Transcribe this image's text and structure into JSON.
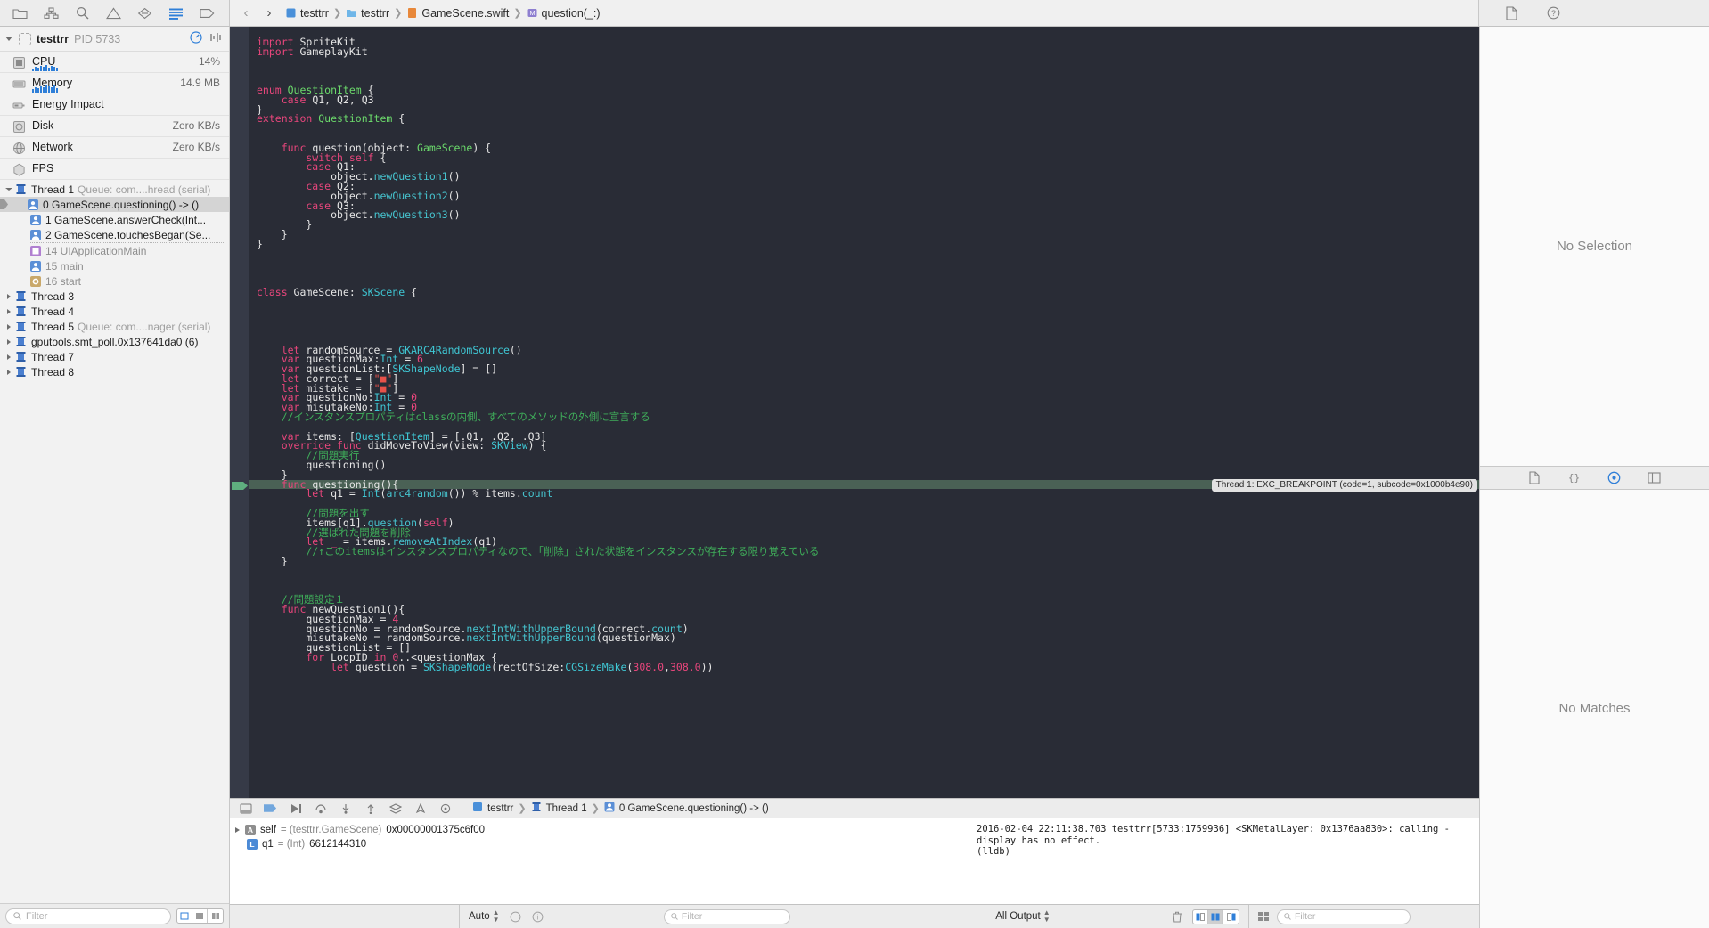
{
  "toolbar": {
    "nav_icons": [
      "folder-icon",
      "hierarchy-icon",
      "search-icon",
      "warning-icon",
      "breakpoint-icon",
      "debug-navigator-icon",
      "tag-icon"
    ],
    "back_label": "‹",
    "forward_label": "›",
    "breadcrumb": [
      {
        "label": "testtrr",
        "icon": "project-icon"
      },
      {
        "label": "testtrr",
        "icon": "folder-icon"
      },
      {
        "label": "GameScene.swift",
        "icon": "swift-file-icon"
      },
      {
        "label": "question(_:)",
        "icon": "method-icon"
      }
    ],
    "right_icons": [
      "document-icon",
      "help-icon"
    ]
  },
  "navigator": {
    "process": {
      "name": "testtrr",
      "pid_label": "PID 5733"
    },
    "gauges": [
      {
        "name": "CPU",
        "value": "14%",
        "icon": "cpu-icon",
        "spark": [
          2,
          4,
          3,
          5,
          4,
          6,
          3,
          5,
          4,
          3
        ]
      },
      {
        "name": "Memory",
        "value": "14.9 MB",
        "icon": "memory-icon",
        "spark": [
          3,
          5,
          4,
          6,
          5,
          7,
          6,
          5,
          7,
          4
        ]
      },
      {
        "name": "Energy Impact",
        "value": "",
        "icon": "energy-icon",
        "spark": []
      },
      {
        "name": "Disk",
        "value": "Zero KB/s",
        "icon": "disk-icon",
        "spark": []
      },
      {
        "name": "Network",
        "value": "Zero KB/s",
        "icon": "network-icon",
        "spark": []
      },
      {
        "name": "FPS",
        "value": "",
        "icon": "fps-icon",
        "spark": []
      }
    ],
    "threads": [
      {
        "kind": "thread",
        "label": "Thread 1",
        "sub": "Queue: com....hread (serial)",
        "expanded": true,
        "indent": 0
      },
      {
        "kind": "frame",
        "label": "0 GameScene.questioning() -> ()",
        "indent": 2,
        "selected": true,
        "color": "#5b8fd6"
      },
      {
        "kind": "frame",
        "label": "1 GameScene.answerCheck(Int...",
        "indent": 2,
        "color": "#5b8fd6"
      },
      {
        "kind": "frame",
        "label": "2 GameScene.touchesBegan(Se...",
        "indent": 2,
        "color": "#5b8fd6"
      },
      {
        "kind": "separator",
        "indent": 2
      },
      {
        "kind": "frame",
        "label": "14 UIApplicationMain",
        "indent": 2,
        "dim": true,
        "color": "#b07fd0"
      },
      {
        "kind": "frame",
        "label": "15 main",
        "indent": 2,
        "dim": true,
        "color": "#5b8fd6"
      },
      {
        "kind": "frame",
        "label": "16 start",
        "indent": 2,
        "dim": true,
        "color": "#c9a86a"
      },
      {
        "kind": "thread",
        "label": "Thread 3",
        "sub": "",
        "expanded": false,
        "indent": 0
      },
      {
        "kind": "thread",
        "label": "Thread 4",
        "sub": "",
        "expanded": false,
        "indent": 0
      },
      {
        "kind": "thread",
        "label": "Thread 5",
        "sub": "Queue: com....nager (serial)",
        "expanded": false,
        "indent": 0
      },
      {
        "kind": "thread",
        "label": "gputools.smt_poll.0x137641da0 (6)",
        "sub": "",
        "expanded": false,
        "indent": 0
      },
      {
        "kind": "thread",
        "label": "Thread 7",
        "sub": "",
        "expanded": false,
        "indent": 0
      },
      {
        "kind": "thread",
        "label": "Thread 8",
        "sub": "",
        "expanded": false,
        "indent": 0
      }
    ],
    "filter_placeholder": "Filter"
  },
  "editor": {
    "lines": [
      [
        {
          "t": "import ",
          "c": "kw"
        },
        {
          "t": "SpriteKit",
          "c": "pl"
        }
      ],
      [
        {
          "t": "import ",
          "c": "kw"
        },
        {
          "t": "GameplayKit",
          "c": "pl"
        }
      ],
      [],
      [],
      [],
      [
        {
          "t": "enum ",
          "c": "kw"
        },
        {
          "t": "QuestionItem",
          "c": "cls"
        },
        {
          "t": " {",
          "c": "pl"
        }
      ],
      [
        {
          "t": "    case ",
          "c": "kw"
        },
        {
          "t": "Q1, Q2, Q3",
          "c": "pl"
        }
      ],
      [
        {
          "t": "}",
          "c": "pl"
        }
      ],
      [
        {
          "t": "extension ",
          "c": "kw"
        },
        {
          "t": "QuestionItem",
          "c": "cls"
        },
        {
          "t": " {",
          "c": "pl"
        }
      ],
      [],
      [],
      [
        {
          "t": "    func ",
          "c": "kw"
        },
        {
          "t": "question",
          "c": "pl"
        },
        {
          "t": "(object: ",
          "c": "pl"
        },
        {
          "t": "GameScene",
          "c": "cls"
        },
        {
          "t": ") {",
          "c": "pl"
        }
      ],
      [
        {
          "t": "        switch self",
          "c": "kw"
        },
        {
          "t": " {",
          "c": "pl"
        }
      ],
      [
        {
          "t": "        case ",
          "c": "kw"
        },
        {
          "t": "Q1:",
          "c": "pl"
        }
      ],
      [
        {
          "t": "            object.",
          "c": "pl"
        },
        {
          "t": "newQuestion1",
          "c": "fn"
        },
        {
          "t": "()",
          "c": "pl"
        }
      ],
      [
        {
          "t": "        case ",
          "c": "kw"
        },
        {
          "t": "Q2:",
          "c": "pl"
        }
      ],
      [
        {
          "t": "            object.",
          "c": "pl"
        },
        {
          "t": "newQuestion2",
          "c": "fn"
        },
        {
          "t": "()",
          "c": "pl"
        }
      ],
      [
        {
          "t": "        case ",
          "c": "kw"
        },
        {
          "t": "Q3:",
          "c": "pl"
        }
      ],
      [
        {
          "t": "            object.",
          "c": "pl"
        },
        {
          "t": "newQuestion3",
          "c": "fn"
        },
        {
          "t": "()",
          "c": "pl"
        }
      ],
      [
        {
          "t": "        }",
          "c": "pl"
        }
      ],
      [
        {
          "t": "    }",
          "c": "pl"
        }
      ],
      [
        {
          "t": "}",
          "c": "pl"
        }
      ],
      [],
      [],
      [],
      [],
      [
        {
          "t": "class ",
          "c": "kw"
        },
        {
          "t": "GameScene",
          "c": "pl"
        },
        {
          "t": ": ",
          "c": "pl"
        },
        {
          "t": "SKScene",
          "c": "typ"
        },
        {
          "t": " {",
          "c": "pl"
        }
      ],
      [],
      [],
      [],
      [],
      [],
      [
        {
          "t": "    let ",
          "c": "kw"
        },
        {
          "t": "randomSource = ",
          "c": "pl"
        },
        {
          "t": "GKARC4RandomSource",
          "c": "typ"
        },
        {
          "t": "()",
          "c": "pl"
        }
      ],
      [
        {
          "t": "    var ",
          "c": "kw"
        },
        {
          "t": "questionMax:",
          "c": "pl"
        },
        {
          "t": "Int",
          "c": "typ"
        },
        {
          "t": " = ",
          "c": "pl"
        },
        {
          "t": "6",
          "c": "num"
        }
      ],
      [
        {
          "t": "    var ",
          "c": "kw"
        },
        {
          "t": "questionList:[",
          "c": "pl"
        },
        {
          "t": "SKShapeNode",
          "c": "typ"
        },
        {
          "t": "] = []",
          "c": "pl"
        }
      ],
      [
        {
          "t": "    let ",
          "c": "kw"
        },
        {
          "t": "correct = [",
          "c": "pl"
        },
        {
          "t": "\"■\"",
          "c": "str"
        },
        {
          "t": "]",
          "c": "pl"
        }
      ],
      [
        {
          "t": "    let ",
          "c": "kw"
        },
        {
          "t": "mistake = [",
          "c": "pl"
        },
        {
          "t": "\"■\"",
          "c": "str"
        },
        {
          "t": "]",
          "c": "pl"
        }
      ],
      [
        {
          "t": "    var ",
          "c": "kw"
        },
        {
          "t": "questionNo:",
          "c": "pl"
        },
        {
          "t": "Int",
          "c": "typ"
        },
        {
          "t": " = ",
          "c": "pl"
        },
        {
          "t": "0",
          "c": "num"
        }
      ],
      [
        {
          "t": "    var ",
          "c": "kw"
        },
        {
          "t": "misutakeNo:",
          "c": "pl"
        },
        {
          "t": "Int",
          "c": "typ"
        },
        {
          "t": " = ",
          "c": "pl"
        },
        {
          "t": "0",
          "c": "num"
        }
      ],
      [
        {
          "t": "    //インスタンスプロパティはclassの内側、すべてのメソッドの外側に宣言する",
          "c": "cmt"
        }
      ],
      [],
      [
        {
          "t": "    var ",
          "c": "kw"
        },
        {
          "t": "items: [",
          "c": "pl"
        },
        {
          "t": "QuestionItem",
          "c": "typ"
        },
        {
          "t": "] = [.Q1, .Q2, .Q3]",
          "c": "pl"
        }
      ],
      [
        {
          "t": "    override func ",
          "c": "kw"
        },
        {
          "t": "didMoveToView",
          "c": "pl"
        },
        {
          "t": "(view: ",
          "c": "pl"
        },
        {
          "t": "SKView",
          "c": "typ"
        },
        {
          "t": ") {",
          "c": "pl"
        }
      ],
      [
        {
          "t": "        //問題実行",
          "c": "cmt"
        }
      ],
      [
        {
          "t": "        questioning()",
          "c": "pl"
        }
      ],
      [
        {
          "t": "    }",
          "c": "pl"
        }
      ],
      [
        {
          "t": "    func ",
          "c": "kw"
        },
        {
          "t": "questioning",
          "c": "pl"
        },
        {
          "t": "(){",
          "c": "pl"
        }
      ],
      [
        {
          "t": "        let ",
          "c": "kw"
        },
        {
          "t": "q1 = ",
          "c": "pl"
        },
        {
          "t": "Int",
          "c": "typ"
        },
        {
          "t": "(",
          "c": "pl"
        },
        {
          "t": "arc4random",
          "c": "fn"
        },
        {
          "t": "()) % items.",
          "c": "pl"
        },
        {
          "t": "count",
          "c": "fn"
        }
      ],
      [],
      [
        {
          "t": "        //問題を出す",
          "c": "cmt"
        }
      ],
      [
        {
          "t": "        items[q1].",
          "c": "pl"
        },
        {
          "t": "question",
          "c": "fn"
        },
        {
          "t": "(",
          "c": "pl"
        },
        {
          "t": "self",
          "c": "kw"
        },
        {
          "t": ")",
          "c": "pl"
        }
      ],
      [
        {
          "t": "        //選ばれた問題を削除",
          "c": "cmt"
        }
      ],
      [
        {
          "t": "        let _ ",
          "c": "kw"
        },
        {
          "t": "= items.",
          "c": "pl"
        },
        {
          "t": "removeAtIndex",
          "c": "fn"
        },
        {
          "t": "(q1)",
          "c": "pl"
        }
      ],
      [
        {
          "t": "        //↑このitemsはインスタンスプロパティなので、「削除」された状態をインスタンスが存在する限り覚えている",
          "c": "cmt"
        }
      ],
      [
        {
          "t": "    }",
          "c": "pl"
        }
      ],
      [],
      [],
      [],
      [
        {
          "t": "    //問題設定１",
          "c": "cmt"
        }
      ],
      [
        {
          "t": "    func ",
          "c": "kw"
        },
        {
          "t": "newQuestion1",
          "c": "pl"
        },
        {
          "t": "(){",
          "c": "pl"
        }
      ],
      [
        {
          "t": "        questionMax = ",
          "c": "pl"
        },
        {
          "t": "4",
          "c": "num"
        }
      ],
      [
        {
          "t": "        questionNo = randomSource.",
          "c": "pl"
        },
        {
          "t": "nextIntWithUpperBound",
          "c": "fn"
        },
        {
          "t": "(correct.",
          "c": "pl"
        },
        {
          "t": "count",
          "c": "fn"
        },
        {
          "t": ")",
          "c": "pl"
        }
      ],
      [
        {
          "t": "        misutakeNo = randomSource.",
          "c": "pl"
        },
        {
          "t": "nextIntWithUpperBound",
          "c": "fn"
        },
        {
          "t": "(questionMax)",
          "c": "pl"
        }
      ],
      [
        {
          "t": "        questionList = []",
          "c": "pl"
        }
      ],
      [
        {
          "t": "        for ",
          "c": "kw"
        },
        {
          "t": "LoopID ",
          "c": "pl"
        },
        {
          "t": "in ",
          "c": "kw"
        },
        {
          "t": "0",
          "c": "num"
        },
        {
          "t": "..<questionMax {",
          "c": "pl"
        }
      ],
      [
        {
          "t": "            let ",
          "c": "kw"
        },
        {
          "t": "question = ",
          "c": "pl"
        },
        {
          "t": "SKShapeNode",
          "c": "typ"
        },
        {
          "t": "(rectOfSize:",
          "c": "pl"
        },
        {
          "t": "CGSizeMake",
          "c": "typ"
        },
        {
          "t": "(",
          "c": "pl"
        },
        {
          "t": "308.0",
          "c": "num"
        },
        {
          "t": ",",
          "c": "pl"
        },
        {
          "t": "308.0",
          "c": "num"
        },
        {
          "t": "))",
          "c": "pl"
        }
      ]
    ],
    "highlight_line_index": 46,
    "exception_badge": "Thread 1: EXC_BREAKPOINT (code=1, subcode=0x1000b4e90)"
  },
  "debugbar": {
    "icons": [
      "hide-debug-area-icon",
      "breakpoints-icon",
      "continue-icon",
      "step-over-icon",
      "step-into-icon",
      "step-out-icon",
      "view-hierarchy-icon",
      "location-icon",
      "memory-graph-icon"
    ],
    "crumb": [
      {
        "label": "testtrr",
        "icon": "project-icon"
      },
      {
        "label": "Thread 1",
        "icon": "thread-icon"
      },
      {
        "label": "0 GameScene.questioning() -> ()",
        "icon": "frame-icon"
      }
    ]
  },
  "variables": [
    {
      "badge": "A",
      "badge_color": "#8e8e8e",
      "name": "self",
      "type": "= (testtrr.GameScene)",
      "value": "0x00000001375c6f00",
      "expandable": true
    },
    {
      "badge": "L",
      "badge_color": "#4b8ad6",
      "name": "q1",
      "type": "= (Int)",
      "value": "6612144310",
      "expandable": false
    }
  ],
  "console": {
    "text": "2016-02-04 22:11:38.703 testtrr[5733:1759936] <SKMetalLayer: 0x1376aa830>: calling -display has no effect.\n(lldb)"
  },
  "statusbar": {
    "auto_label": "Auto",
    "filter_placeholder": "Filter",
    "output_label": "All Output",
    "right_filter_placeholder": "Filter"
  },
  "utility": {
    "top_text": "No Selection",
    "bottom_text": "No Matches",
    "tabs": [
      "file-inspector-icon",
      "quick-help-icon",
      "identity-icon",
      "attributes-icon"
    ]
  },
  "colors": {
    "editor_bg": "#292c36",
    "gutter_bg": "#363a47",
    "highlight": "#4a6155",
    "keyword": "#e8467c",
    "type": "#3fc7d4",
    "class": "#6bd96b",
    "comment": "#3fae5a",
    "string": "#e8524a",
    "accent": "#2f7fd8"
  }
}
